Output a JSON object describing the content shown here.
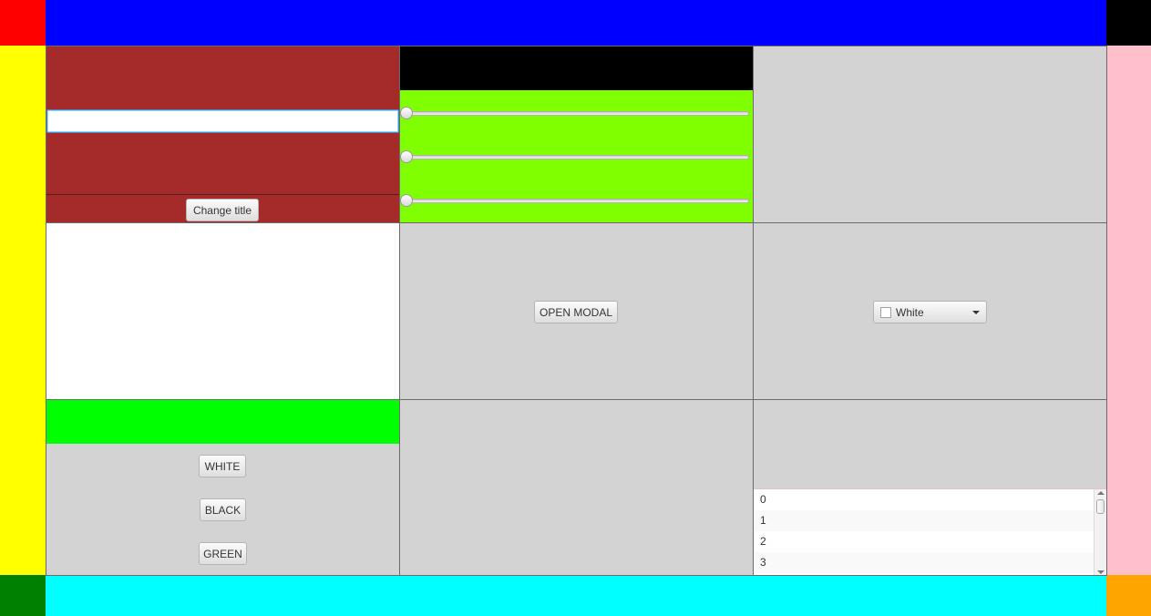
{
  "colors": {
    "corner_top_left": "#ff0000",
    "top_bar": "#0000ff",
    "corner_top_right": "#000000",
    "left_bar": "#ffff00",
    "right_bar": "#ffc0cb",
    "corner_bottom_left": "#008000",
    "bottom_bar": "#00ffff",
    "corner_bottom_right": "#ffa500",
    "title_panel": "#a52a2a",
    "slider_panel_top": "#000000",
    "slider_panel": "#7fff00",
    "color_header": "#00ff00",
    "grey_panel": "#d3d3d3"
  },
  "title_panel": {
    "input_value": "",
    "change_title_label": "Change title"
  },
  "sliders": {
    "values": [
      0,
      0,
      0
    ]
  },
  "modal_panel": {
    "open_modal_label": "OPEN MODAL"
  },
  "color_picker": {
    "selected_label": "White",
    "swatch_color": "#ffffff"
  },
  "color_buttons": {
    "white_label": "WHITE",
    "black_label": "BLACK",
    "green_label": "GREEN"
  },
  "number_list": {
    "items": [
      "0",
      "1",
      "2",
      "3"
    ]
  }
}
